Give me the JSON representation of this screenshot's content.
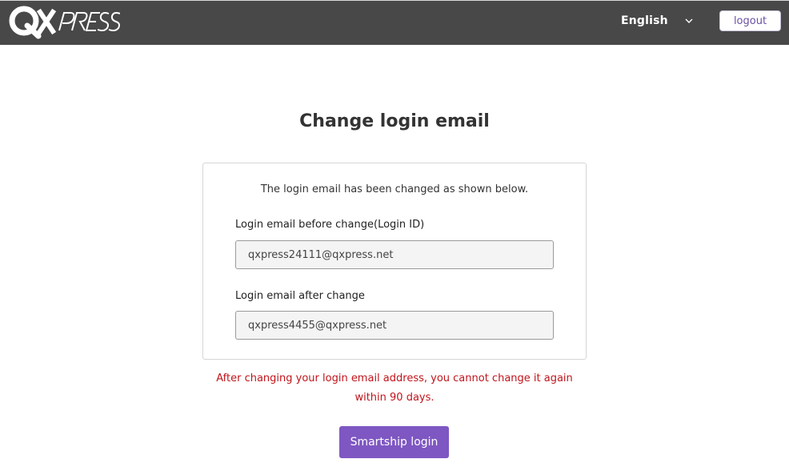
{
  "header": {
    "logo_text": "QXPRESS",
    "language": "English",
    "logout_label": "logout"
  },
  "page": {
    "title": "Change login email"
  },
  "card": {
    "message": "The login email has been changed as shown below.",
    "before_label": "Login email before change(Login ID)",
    "before_value": "qxpress24111@qxpress.net",
    "after_label": "Login email after change",
    "after_value": "qxpress4455@qxpress.net"
  },
  "warning": "After changing your login email address, you cannot change it again within 90 days.",
  "actions": {
    "smartship_login_label": "Smartship login"
  },
  "colors": {
    "topbar": "#484848",
    "accent": "#7e57c2",
    "warning": "#c0141a"
  }
}
